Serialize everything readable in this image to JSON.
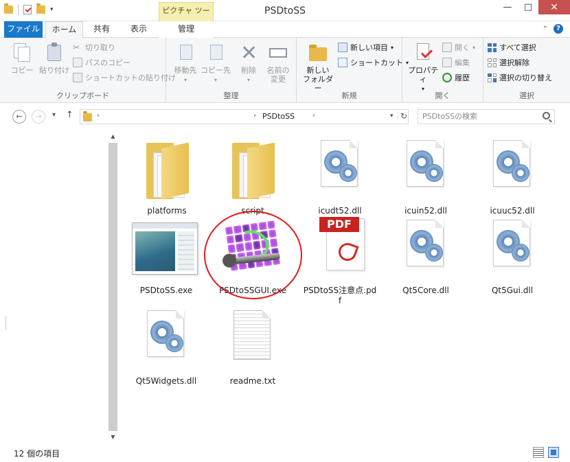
{
  "window": {
    "title": "PSDtoSS",
    "contextual_tab_group": "ピクチャ ツール",
    "minimize": "—",
    "maximize": "□",
    "close": "✕"
  },
  "tabs": {
    "file": "ファイル",
    "home": "ホーム",
    "share": "共有",
    "view": "表示",
    "manage": "管理"
  },
  "ribbon": {
    "clipboard": {
      "label": "クリップボード",
      "copy": "コピー",
      "paste": "貼り付け",
      "cut": "切り取り",
      "copy_path": "パスのコピー",
      "paste_shortcut": "ショートカットの貼り付け"
    },
    "organize": {
      "label": "整理",
      "move_to": "移動先",
      "copy_to": "コピー先",
      "delete": "削除",
      "rename_line1": "名前の",
      "rename_line2": "変更"
    },
    "new": {
      "label": "新規",
      "new_folder_line1": "新しい",
      "new_folder_line2": "フォルダー",
      "new_item": "新しい項目",
      "easy_access": "ショートカット"
    },
    "open": {
      "label": "開く",
      "properties": "プロパティ",
      "open": "開く",
      "edit": "編集",
      "history": "履歴"
    },
    "select": {
      "label": "選択",
      "select_all": "すべて選択",
      "select_none": "選択解除",
      "invert": "選択の切り替え"
    }
  },
  "address": {
    "path": "PSDtoSS",
    "search_placeholder": "PSDtoSSの検索"
  },
  "files": [
    {
      "name": "platforms",
      "type": "folder"
    },
    {
      "name": "script",
      "type": "folder"
    },
    {
      "name": "icudt52.dll",
      "type": "dll"
    },
    {
      "name": "icuin52.dll",
      "type": "dll"
    },
    {
      "name": "icuuc52.dll",
      "type": "dll"
    },
    {
      "name": "PSDtoSS.exe",
      "type": "exe"
    },
    {
      "name": "PSDtoSSGUI.exe",
      "type": "gui-exe",
      "highlighted": true
    },
    {
      "name": "PSDtoSS注意点.pdf",
      "type": "pdf"
    },
    {
      "name": "Qt5Core.dll",
      "type": "dll"
    },
    {
      "name": "Qt5Gui.dll",
      "type": "dll"
    },
    {
      "name": "Qt5Widgets.dll",
      "type": "dll"
    },
    {
      "name": "readme.txt",
      "type": "txt"
    }
  ],
  "status": {
    "item_count": "12 個の項目"
  },
  "colors": {
    "file_tab": "#1979ca",
    "highlight_ring": "#e01a1a",
    "contextual_tab": "#f6efb3"
  }
}
